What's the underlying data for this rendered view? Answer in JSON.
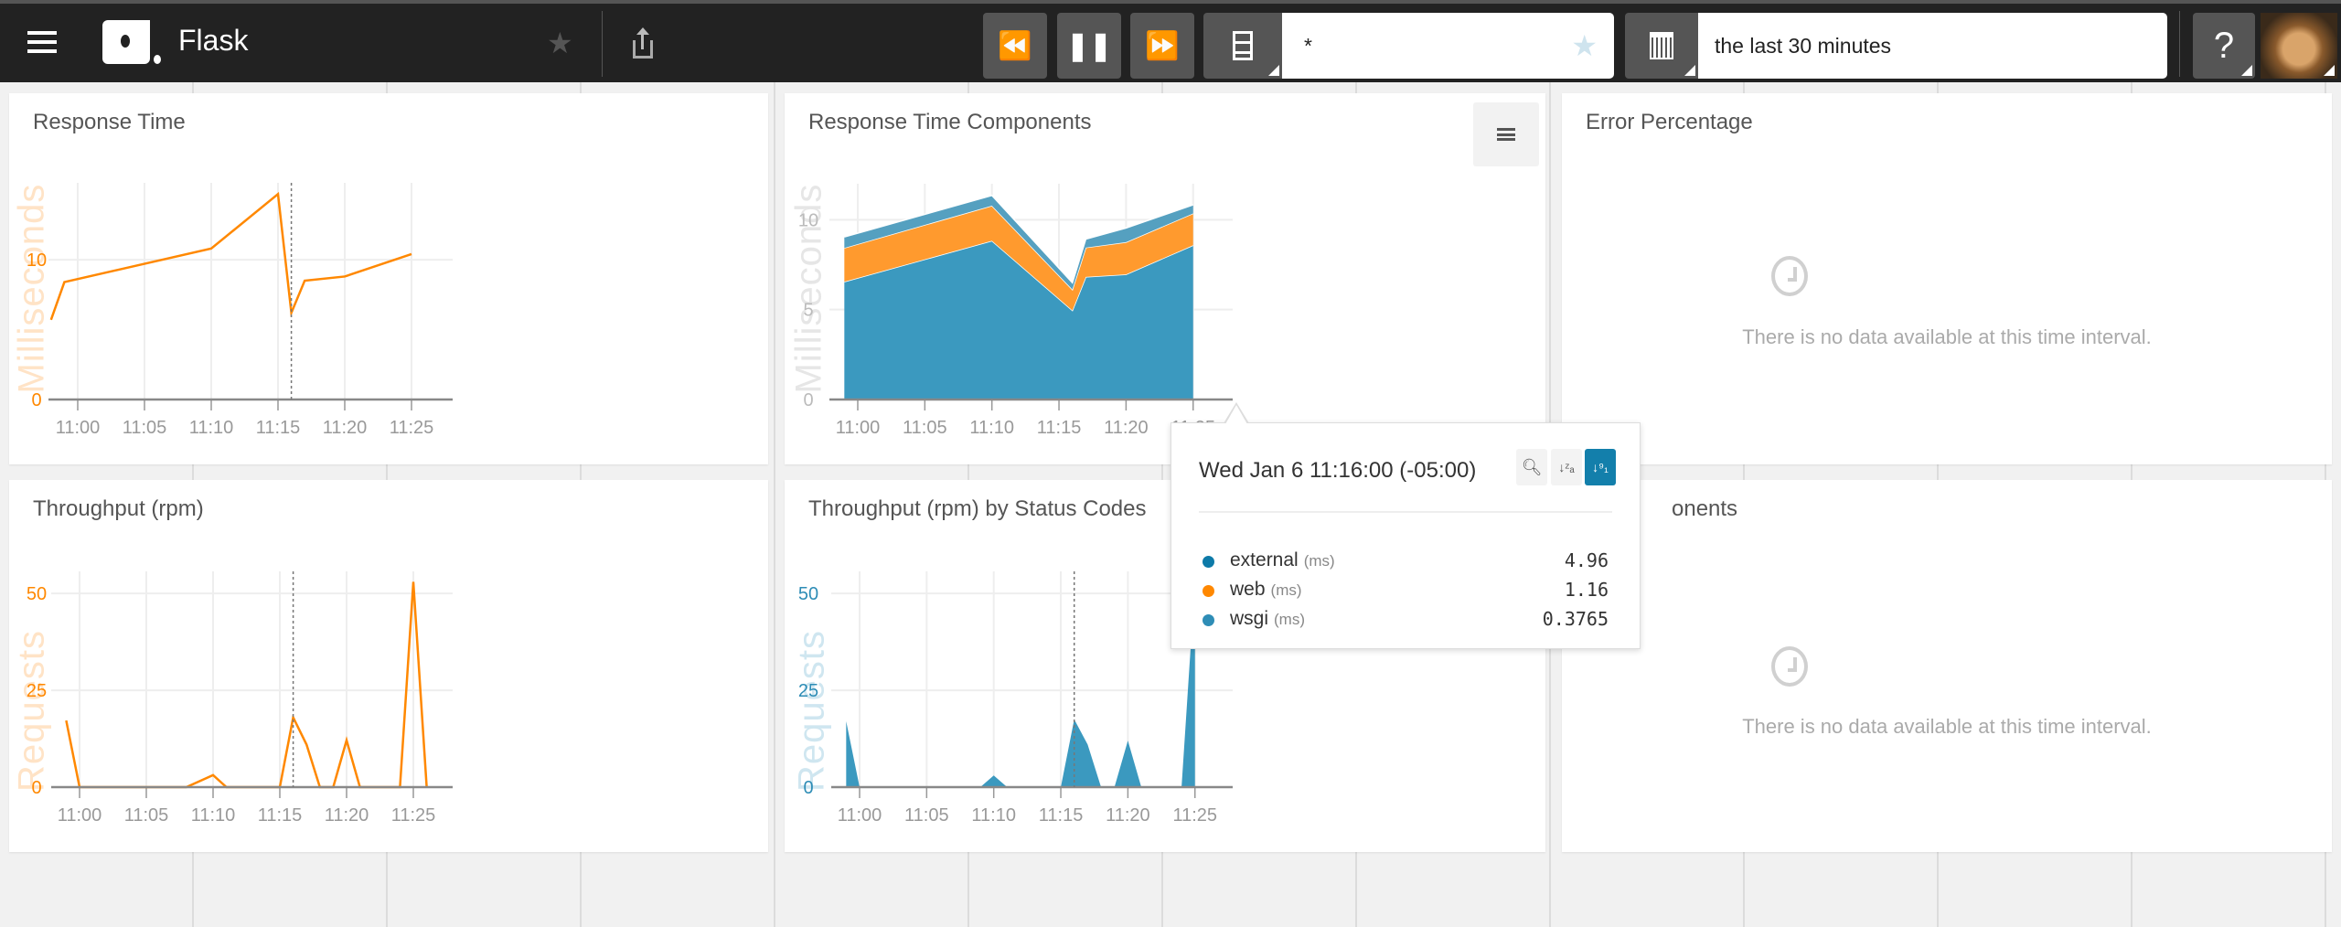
{
  "header": {
    "app_name": "Flask",
    "filter_value": "*",
    "time_range": "the last 30 minutes",
    "help_label": "?",
    "icons": [
      "hamburger-menu-icon",
      "app-logo",
      "favorite-star-icon",
      "share-icon",
      "rewind-icon",
      "pause-icon",
      "fast-forward-icon",
      "view-selector-icon",
      "calendar-icon",
      "help-icon",
      "user-avatar"
    ]
  },
  "panels": {
    "response_time": {
      "title": "Response Time"
    },
    "components": {
      "title": "Response Time Components"
    },
    "error": {
      "title": "Error Percentage",
      "empty": "There is no data available at this time interval."
    },
    "throughput": {
      "title": "Throughput (rpm)"
    },
    "status_codes": {
      "title": "Throughput (rpm) by Status Codes"
    },
    "other_components": {
      "title_visible": "onents",
      "empty": "There is no data available at this time interval."
    }
  },
  "tooltip": {
    "timestamp": "Wed Jan 6 11:16:00 (-05:00)",
    "rows": [
      {
        "name": "external",
        "unit": "(ms)",
        "value": "4.96",
        "color": "#0d7aa8"
      },
      {
        "name": "web",
        "unit": "(ms)",
        "value": "1.16",
        "color": "#ff8800"
      },
      {
        "name": "wsgi",
        "unit": "(ms)",
        "value": "0.3765",
        "color": "#2e8db6"
      }
    ],
    "sort_active": "numeric-desc"
  },
  "chart_data": [
    {
      "type": "line",
      "ylabel": "Milliseconds",
      "ylim": [
        0,
        15.5
      ],
      "yticks": [
        "0",
        "10"
      ],
      "xticks": [
        "11:00",
        "11:05",
        "11:10",
        "11:15",
        "11:20",
        "11:25"
      ],
      "grid": true,
      "hover": "11:16",
      "color": "#ff8800",
      "x": [
        "10:58",
        "10:59",
        "11:10",
        "11:15",
        "11:16",
        "11:17",
        "11:20",
        "11:25"
      ],
      "values": [
        5.7,
        8.4,
        10.8,
        14.7,
        6.2,
        8.5,
        8.8,
        10.4
      ]
    },
    {
      "type": "area",
      "stacked": true,
      "ylabel": "Milliseconds",
      "ylim": [
        0,
        12
      ],
      "yticks": [
        "0",
        "5",
        "10"
      ],
      "xticks": [
        "11:00",
        "11:05",
        "11:10",
        "11:15",
        "11:20",
        "11:25"
      ],
      "grid": true,
      "x": [
        "10:59",
        "11:10",
        "11:16",
        "11:17",
        "11:20",
        "11:25"
      ],
      "series": [
        {
          "name": "external",
          "color": "#3b99bf",
          "values": [
            6.55,
            8.83,
            4.96,
            6.82,
            6.96,
            8.58
          ]
        },
        {
          "name": "web",
          "color": "#ff9a2e",
          "values": [
            1.88,
            1.95,
            1.16,
            1.63,
            1.79,
            1.77
          ]
        },
        {
          "name": "wsgi",
          "color": "#55a0c0",
          "values": [
            0.61,
            0.57,
            0.3765,
            0.47,
            0.79,
            0.48
          ]
        }
      ]
    },
    {
      "type": "line",
      "ylabel": "Requests",
      "ylim": [
        0,
        55.7
      ],
      "yticks": [
        "0",
        "25",
        "50"
      ],
      "xticks": [
        "11:00",
        "11:05",
        "11:10",
        "11:15",
        "11:20",
        "11:25"
      ],
      "grid": true,
      "hover": "11:16",
      "color": "#ff8800",
      "x": [
        "10:59",
        "11:00",
        "11:08",
        "11:10",
        "11:11",
        "11:15",
        "11:16",
        "11:17",
        "11:18",
        "11:19",
        "11:20",
        "11:21",
        "11:24",
        "11:25",
        "11:26"
      ],
      "values": [
        17.2,
        0,
        0,
        3.1,
        0,
        0,
        18,
        11,
        0,
        0,
        12.1,
        0,
        0,
        53,
        0
      ]
    },
    {
      "type": "area",
      "ylabel": "Requests",
      "ylim": [
        0,
        55.7
      ],
      "yticks": [
        "0",
        "25",
        "50"
      ],
      "xticks": [
        "11:00",
        "11:05",
        "11:10",
        "11:15",
        "11:20",
        "11:25"
      ],
      "grid": true,
      "hover": "11:16",
      "color": "#3b99bf",
      "x": [
        "10:59",
        "11:00",
        "11:09",
        "11:10",
        "11:11",
        "11:15",
        "11:16",
        "11:17",
        "11:18",
        "11:19",
        "11:20",
        "11:21",
        "11:24",
        "11:25"
      ],
      "values": [
        17,
        0,
        0,
        3,
        0,
        0,
        17.5,
        11,
        0,
        0,
        12,
        0,
        0,
        53
      ]
    }
  ]
}
